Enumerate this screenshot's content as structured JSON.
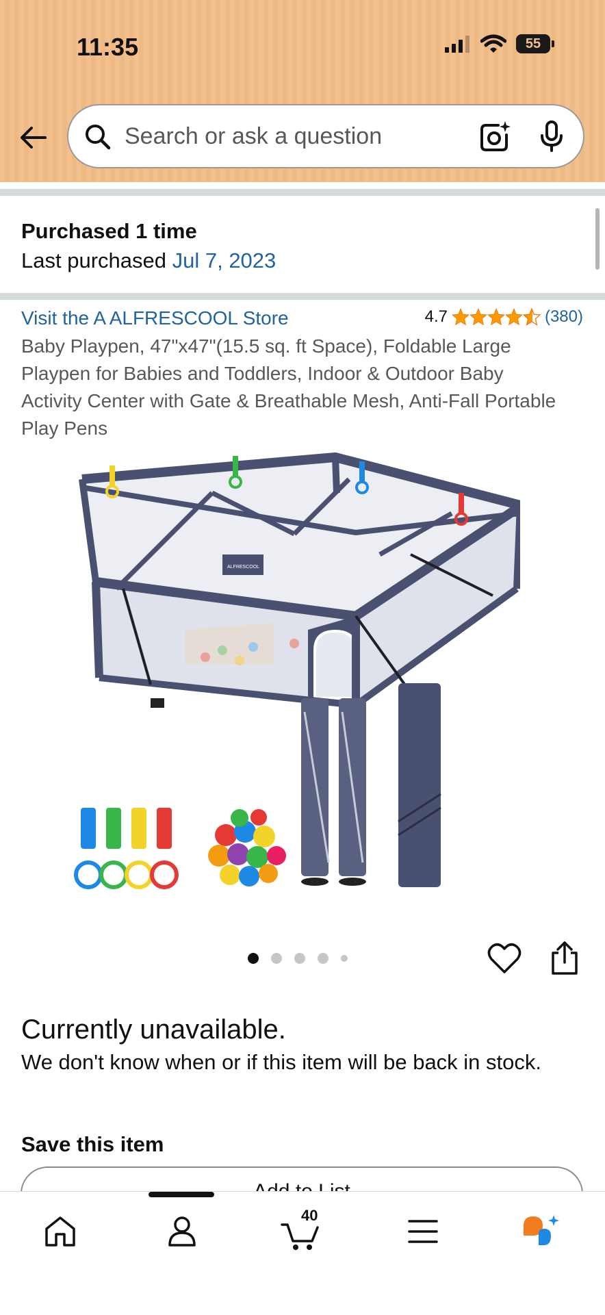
{
  "status_bar": {
    "time": "11:35",
    "battery": "55"
  },
  "search": {
    "placeholder": "Search or ask a question"
  },
  "purchase_info": {
    "title": "Purchased 1 time",
    "last_label": "Last purchased",
    "last_date": "Jul 7, 2023"
  },
  "product": {
    "store_link": "Visit the A ALFRESCOOL Store",
    "rating_value": "4.7",
    "rating_stars": 4.7,
    "rating_count": "(380)",
    "title": "Baby Playpen, 47\"x47\"(15.5 sq. ft Space), Foldable Large Playpen for Babies and Toddlers, Indoor & Outdoor Baby Activity Center with Gate & Breathable Mesh, Anti-Fall Portable Play Pens",
    "brand_tag": "ALFRESCOOL",
    "image_index": 1,
    "image_count": 5
  },
  "availability": {
    "status": "Currently unavailable.",
    "description": "We don't know when or if this item will be back in stock."
  },
  "save": {
    "title": "Save this item",
    "add_to_list_label": "Add to List"
  },
  "tabbar": {
    "cart_count": "40"
  },
  "colors": {
    "header": "#f2c08f",
    "link": "#2162a1",
    "star": "#ff9900",
    "playpen": "#4a5070"
  },
  "icons": [
    "back-arrow-icon",
    "search-icon",
    "camera-icon",
    "mic-icon",
    "star-icon",
    "heart-icon",
    "share-icon",
    "home-icon",
    "profile-icon",
    "cart-icon",
    "menu-icon",
    "rufus-icon"
  ]
}
